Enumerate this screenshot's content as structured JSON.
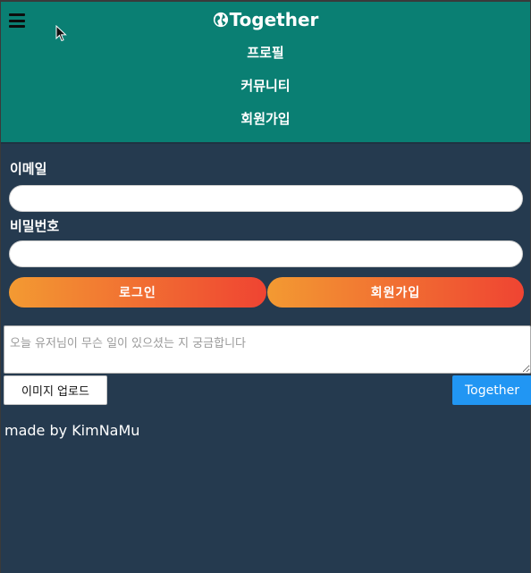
{
  "header": {
    "brand": "Together",
    "brand_icon": "globe-icon",
    "menu_icon": "hamburger-icon",
    "background": "#0a7f73",
    "nav": [
      {
        "label": "프로필"
      },
      {
        "label": "커뮤니티"
      },
      {
        "label": "회원가입"
      }
    ]
  },
  "login_form": {
    "email_label": "이메일",
    "email_value": "",
    "password_label": "비밀번호",
    "password_value": "",
    "login_button": "로그인",
    "signup_button": "회원가입",
    "button_gradient": [
      "#f39a32",
      "#ef4432"
    ]
  },
  "post": {
    "placeholder": "오늘 유저님이 무슨 일이 있으셨는 지 궁금합니다",
    "upload_button": "이미지 업로드",
    "submit_button": "Together",
    "submit_color": "#2196f3"
  },
  "footer": {
    "text": "made by KimNaMu"
  },
  "page": {
    "background": "#253a4f"
  }
}
